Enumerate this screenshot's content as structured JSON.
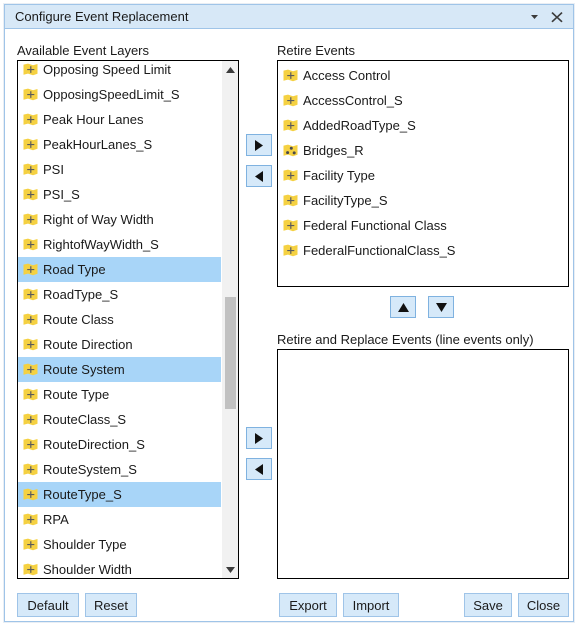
{
  "window": {
    "title": "Configure Event Replacement",
    "minimize_icon": "chevron-down-icon",
    "close_icon": "close-icon"
  },
  "available_panel": {
    "label": "Available Event Layers",
    "items": [
      {
        "label": "Opposing Speed Limit",
        "icon": "line-layer-icon",
        "selected": false
      },
      {
        "label": "OpposingSpeedLimit_S",
        "icon": "line-layer-icon",
        "selected": false
      },
      {
        "label": "Peak Hour Lanes",
        "icon": "line-layer-icon",
        "selected": false
      },
      {
        "label": "PeakHourLanes_S",
        "icon": "line-layer-icon",
        "selected": false
      },
      {
        "label": "PSI",
        "icon": "line-layer-icon",
        "selected": false
      },
      {
        "label": "PSI_S",
        "icon": "line-layer-icon",
        "selected": false
      },
      {
        "label": "Right of Way Width",
        "icon": "line-layer-icon",
        "selected": false
      },
      {
        "label": "RightofWayWidth_S",
        "icon": "line-layer-icon",
        "selected": false
      },
      {
        "label": "Road Type",
        "icon": "line-layer-icon",
        "selected": true
      },
      {
        "label": "RoadType_S",
        "icon": "line-layer-icon",
        "selected": false
      },
      {
        "label": "Route Class",
        "icon": "line-layer-icon",
        "selected": false
      },
      {
        "label": "Route Direction",
        "icon": "line-layer-icon",
        "selected": false
      },
      {
        "label": "Route System",
        "icon": "line-layer-icon",
        "selected": true
      },
      {
        "label": "Route Type",
        "icon": "line-layer-icon",
        "selected": false
      },
      {
        "label": "RouteClass_S",
        "icon": "line-layer-icon",
        "selected": false
      },
      {
        "label": "RouteDirection_S",
        "icon": "line-layer-icon",
        "selected": false
      },
      {
        "label": "RouteSystem_S",
        "icon": "line-layer-icon",
        "selected": false
      },
      {
        "label": "RouteType_S",
        "icon": "line-layer-icon",
        "selected": true
      },
      {
        "label": "RPA",
        "icon": "line-layer-icon",
        "selected": false
      },
      {
        "label": "Shoulder Type",
        "icon": "line-layer-icon",
        "selected": false
      },
      {
        "label": "Shoulder Width",
        "icon": "line-layer-icon",
        "selected": false
      }
    ],
    "scrollbar": {
      "up_arrow": "scroll-up-icon",
      "down_arrow": "scroll-down-icon"
    }
  },
  "retire_panel": {
    "label": "Retire Events",
    "items": [
      {
        "label": "Access Control",
        "icon": "line-layer-icon"
      },
      {
        "label": "AccessControl_S",
        "icon": "line-layer-icon"
      },
      {
        "label": "AddedRoadType_S",
        "icon": "line-layer-icon"
      },
      {
        "label": "Bridges_R",
        "icon": "point-layer-icon"
      },
      {
        "label": "Facility Type",
        "icon": "line-layer-icon"
      },
      {
        "label": "FacilityType_S",
        "icon": "line-layer-icon"
      },
      {
        "label": "Federal Functional Class",
        "icon": "line-layer-icon"
      },
      {
        "label": "FederalFunctionalClass_S",
        "icon": "line-layer-icon"
      }
    ]
  },
  "retire_replace_panel": {
    "label": "Retire and Replace Events (line events only)",
    "items": []
  },
  "transfer_buttons": {
    "retire_add": "move-right-icon",
    "retire_remove": "move-left-icon",
    "replace_add": "move-right-icon",
    "replace_remove": "move-left-icon"
  },
  "order_buttons": {
    "move_up": "move-up-icon",
    "move_down": "move-down-icon"
  },
  "footer": {
    "default_label": "Default",
    "reset_label": "Reset",
    "export_label": "Export",
    "import_label": "Import",
    "save_label": "Save",
    "close_label": "Close"
  },
  "colors": {
    "title_bar": "#d7e8f7",
    "selection": "#a8d5f8",
    "button_face": "#d6e9f9",
    "border": "#9fc4e8",
    "layer_icon": "#f5d142"
  }
}
